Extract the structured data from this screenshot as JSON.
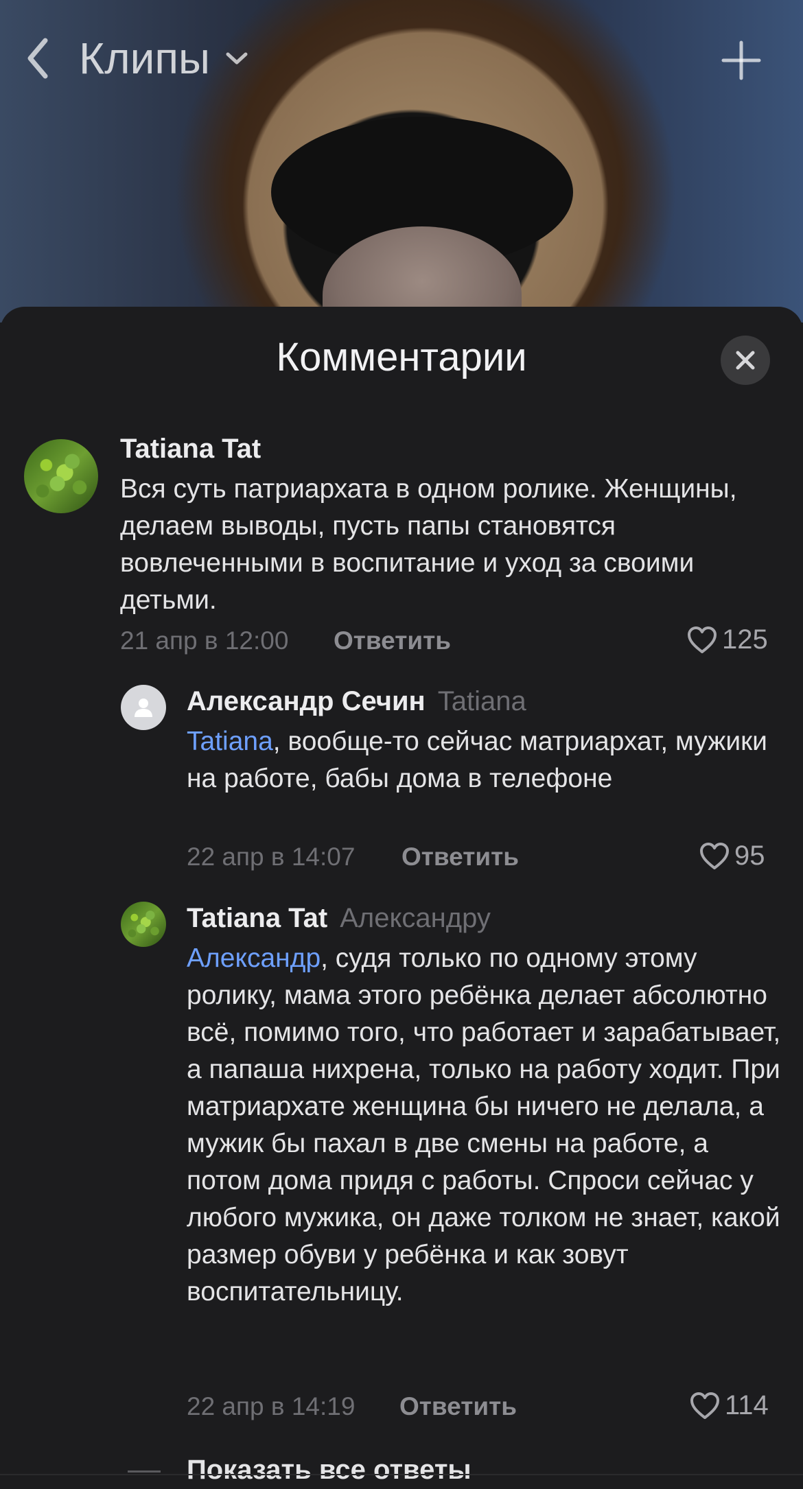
{
  "header": {
    "title": "Клипы"
  },
  "sheet": {
    "title": "Комментарии"
  },
  "comments": [
    {
      "author": "Tatiana Tat",
      "reply_to": "",
      "mention": "",
      "text": "Вся суть патриархата в одном ролике. Женщины, делаем выводы, пусть папы становятся вовлеченными в воспитание и уход за своими детьми.",
      "date": "21 апр в 12:00",
      "reply_label": "Ответить",
      "likes": "125"
    },
    {
      "author": "Александр Сечин",
      "reply_to": "Tatiana",
      "mention": "Tatiana",
      "text": ", вообще-то сейчас матриархат, мужики на работе, бабы дома в телефоне",
      "date": "22 апр в 14:07",
      "reply_label": "Ответить",
      "likes": "95"
    },
    {
      "author": "Tatiana Tat",
      "reply_to": "Александру",
      "mention": "Александр",
      "text": ", судя только по одному этому ролику, мама этого ребёнка делает абсолютно всё, помимо того, что работает и зарабатывает, а папаша нихрена, только на работу ходит. При матриархате женщина бы ничего не делала, а мужик бы пахал в две смены на работе, а потом дома придя с работы. Спроси сейчас у любого мужика, он даже толком не знает, какой размер обуви у ребёнка и как зовут воспитательницу.",
      "date": "22 апр в 14:19",
      "reply_label": "Ответить",
      "likes": "114"
    }
  ],
  "show_all_label": "Показать все ответы",
  "colors": {
    "sheet_bg": "#1c1c1e",
    "mention": "#6ea0ff",
    "muted": "#6f6f74"
  }
}
